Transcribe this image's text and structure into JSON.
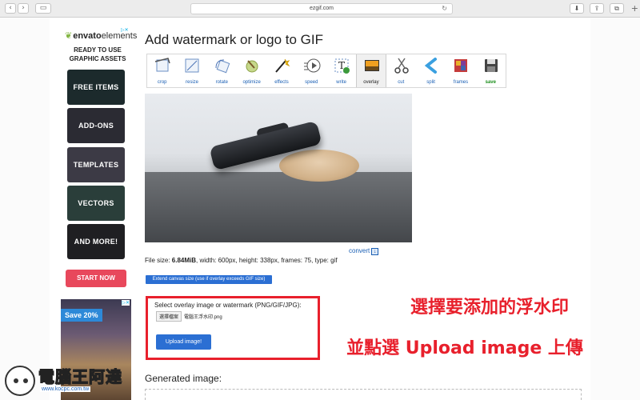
{
  "browser": {
    "url": "ezgif.com",
    "reload_glyph": "↻",
    "back_glyph": "‹",
    "forward_glyph": "›",
    "sidebar_glyph": "▭",
    "download_glyph": "⬇",
    "share_glyph": "⇪",
    "tabs_glyph": "⧉",
    "new_tab_glyph": "+"
  },
  "ad_envato": {
    "brand": "envato",
    "brand_suffix": "elements",
    "ad_marker": "▷✕",
    "tagline": "READY TO USE GRAPHIC ASSETS",
    "cards": [
      {
        "label": "FREE ITEMS",
        "color": "#1c2a2c"
      },
      {
        "label": "ADD-ONS",
        "color": "#2b2b33"
      },
      {
        "label": "TEMPLATES",
        "color": "#3c3a45"
      },
      {
        "label": "VECTORS",
        "color": "#2a3e3a"
      },
      {
        "label": "AND MORE!",
        "color": "#1f1f22"
      }
    ],
    "cta": "START NOW"
  },
  "ad_hotel": {
    "badge": "Save 20%",
    "ad_marker": "▷✕"
  },
  "page": {
    "title": "Add watermark or logo to GIF"
  },
  "tools": [
    {
      "label": "crop",
      "icon": "crop-icon"
    },
    {
      "label": "resize",
      "icon": "resize-icon"
    },
    {
      "label": "rotate",
      "icon": "rotate-icon"
    },
    {
      "label": "optimize",
      "icon": "optimize-icon"
    },
    {
      "label": "effects",
      "icon": "effects-icon"
    },
    {
      "label": "speed",
      "icon": "speed-icon"
    },
    {
      "label": "write",
      "icon": "write-icon"
    },
    {
      "label": "overlay",
      "icon": "overlay-icon"
    },
    {
      "label": "cut",
      "icon": "cut-icon"
    },
    {
      "label": "split",
      "icon": "split-icon"
    },
    {
      "label": "frames",
      "icon": "frames-icon"
    },
    {
      "label": "save",
      "icon": "save-icon"
    }
  ],
  "file": {
    "info_prefix": "File size: ",
    "size": "6.84MiB",
    "info_rest": ", width: 600px, height: 338px, frames: 75, type: gif",
    "convert": "convert"
  },
  "extend_button": "Extend canvas size (use if overlay exceeds GIF size)",
  "overlay": {
    "label": "Select overlay image or watermark (PNG/GIF/JPG):",
    "choose_file": "選擇檔案",
    "file_name": "電腦王浮水印.png",
    "upload": "Upload image!"
  },
  "callouts": {
    "line1": "選擇要添加的浮水印",
    "line2": "並點選 Upload image 上傳"
  },
  "generated_label": "Generated image:",
  "watermark": {
    "text": "電腦王阿達",
    "url": "www.kocpc.com.tw"
  }
}
